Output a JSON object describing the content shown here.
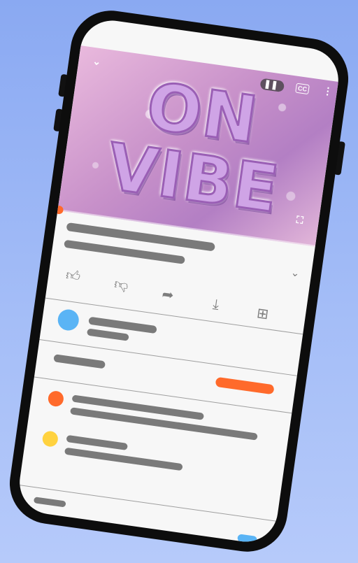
{
  "video": {
    "art_text": [
      "ON",
      "VIBE"
    ],
    "cc_label": "CC",
    "progress": 0.0
  },
  "icons": {
    "minimize": "chevron-down-icon",
    "pause": "pause-icon",
    "captions": "cc-icon",
    "more": "more-vertical-icon",
    "fullscreen": "fullscreen-icon",
    "expand": "chevron-down-icon",
    "like": "thumbs-up-icon",
    "dislike": "thumbs-down-icon",
    "share": "share-icon",
    "download": "download-icon",
    "save": "add-to-playlist-icon"
  },
  "colors": {
    "accent": "#ff6a2b",
    "channel_avatar": "#5ab4f5",
    "comment_avatar_1": "#ff6a2b",
    "comment_avatar_2": "#ffd23f",
    "toggle": "#5ab4f5",
    "placeholder_bar": "#7a7a7a",
    "phone_frame": "#0d0d0d",
    "background": "#9bb5f5"
  }
}
